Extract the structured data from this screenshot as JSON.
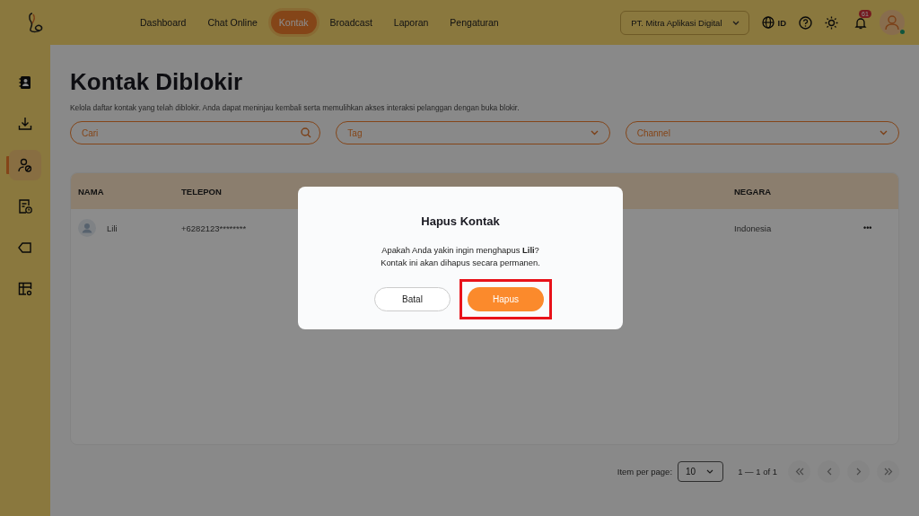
{
  "nav": [
    {
      "label": "Dashboard",
      "selected": false
    },
    {
      "label": "Chat Online",
      "selected": false
    },
    {
      "label": "Kontak",
      "selected": true
    },
    {
      "label": "Broadcast",
      "selected": false
    },
    {
      "label": "Laporan",
      "selected": false
    },
    {
      "label": "Pengaturan",
      "selected": false
    }
  ],
  "company_select": {
    "value": "PT. Mitra Aplikasi Digital"
  },
  "language": "ID",
  "notifications": {
    "count": "61"
  },
  "user": {
    "online": true
  },
  "sidebar": {
    "items": [
      {
        "kind": "contacts",
        "selected": false
      },
      {
        "kind": "import",
        "selected": false
      },
      {
        "kind": "blocked",
        "selected": true
      },
      {
        "kind": "history",
        "selected": false
      },
      {
        "kind": "tag",
        "selected": false
      },
      {
        "kind": "table",
        "selected": false
      }
    ]
  },
  "page": {
    "title": "Kontak Diblokir",
    "description": "Kelola daftar kontak yang telah diblokir. Anda dapat meninjau kembali serta memulihkan akses interaksi pelanggan dengan buka blokir."
  },
  "filters": {
    "search": {
      "placeholder": "Cari"
    },
    "tag": {
      "placeholder": "Tag"
    },
    "channel": {
      "placeholder": "Channel"
    }
  },
  "table": {
    "columns": [
      {
        "label": "NAMA"
      },
      {
        "label": "TELEPON"
      },
      {
        "label": "NEGARA"
      }
    ],
    "rows": [
      {
        "nama": "Lili",
        "telepon": "+6282123********",
        "negara": "Indonesia",
        "menu": "•••"
      }
    ]
  },
  "pagination": {
    "label": "Item per page:",
    "per_page": "10",
    "range": "1 — 1 of 1"
  },
  "modal": {
    "title": "Hapus Kontak",
    "message": "Apakah Anda yakin ingin menghapus **Lili**?\nKontak ini akan dihapus secara permanen.",
    "buttons": [
      {
        "label": "Batal",
        "kind": "secondary",
        "highlighted": false
      },
      {
        "label": "Hapus",
        "kind": "primary",
        "highlighted": true
      }
    ]
  }
}
